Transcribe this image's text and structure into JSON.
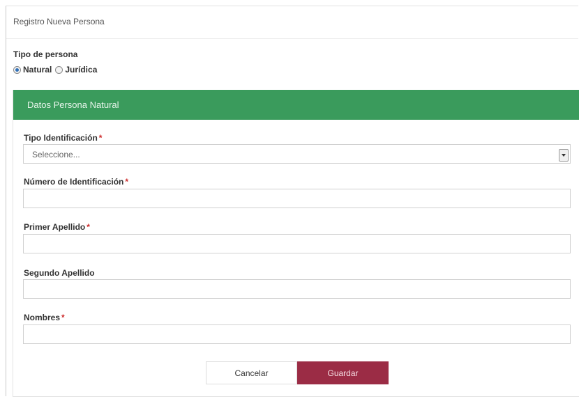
{
  "page": {
    "title": "Registro Nueva Persona"
  },
  "tipo_persona": {
    "label": "Tipo de persona",
    "options": [
      {
        "label": "Natural",
        "checked": true
      },
      {
        "label": "Jurídica",
        "checked": false
      }
    ]
  },
  "panel": {
    "header": "Datos Persona Natural",
    "header_color": "#3a9b5c",
    "fields": {
      "tipo_identificacion": {
        "label": "Tipo Identificación",
        "required_mark": "*",
        "value": "Seleccione..."
      },
      "numero_identificacion": {
        "label": "Número de Identificación",
        "required_mark": "*",
        "value": ""
      },
      "primer_apellido": {
        "label": "Primer Apellido",
        "required_mark": "*",
        "value": ""
      },
      "segundo_apellido": {
        "label": "Segundo Apellido",
        "value": ""
      },
      "nombres": {
        "label": "Nombres",
        "required_mark": "*",
        "value": ""
      }
    }
  },
  "actions": {
    "cancel_label": "Cancelar",
    "save_label": "Guardar",
    "save_color": "#9b2c45"
  }
}
